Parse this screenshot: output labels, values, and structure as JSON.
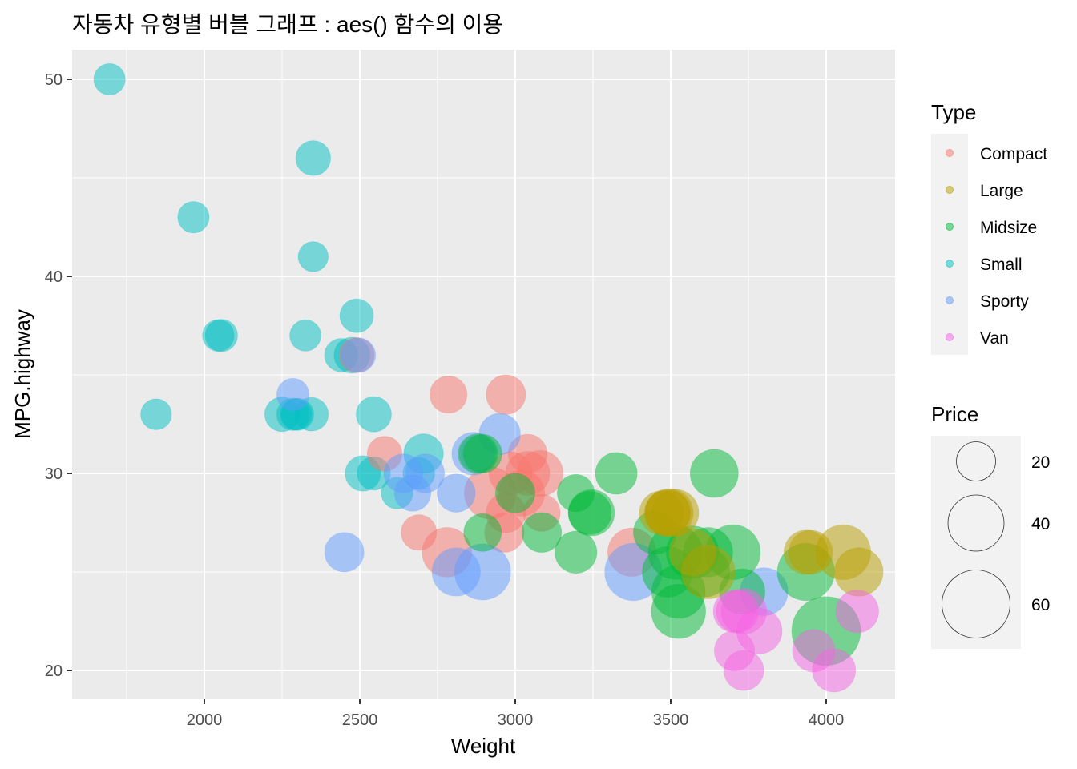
{
  "chart_data": {
    "type": "scatter",
    "subtype": "bubble",
    "title": "자동차 유형별 버블 그래프 : aes() 함수의 이용",
    "xlabel": "Weight",
    "ylabel": "MPG.highway",
    "xlim": [
      1600,
      4250
    ],
    "ylim": [
      18.5,
      51.5
    ],
    "x_ticks": [
      2000,
      2500,
      3000,
      3500,
      4000
    ],
    "y_ticks": [
      20,
      30,
      40,
      50
    ],
    "x_tick_labels": [
      "2000",
      "2500",
      "3000",
      "3500",
      "4000"
    ],
    "y_tick_labels": [
      "20",
      "30",
      "40",
      "50"
    ],
    "grid": true,
    "point_alpha": 0.5,
    "color_legend": {
      "title": "Type",
      "placement": "right",
      "entries": [
        {
          "label": "Compact",
          "color": "#F8766D"
        },
        {
          "label": "Large",
          "color": "#B79F00"
        },
        {
          "label": "Midsize",
          "color": "#00BA38"
        },
        {
          "label": "Small",
          "color": "#00BFC4"
        },
        {
          "label": "Sporty",
          "color": "#619CFF"
        },
        {
          "label": "Van",
          "color": "#F564E3"
        }
      ]
    },
    "size_legend": {
      "title": "Price",
      "placement": "right",
      "breaks": [
        20,
        40,
        60
      ],
      "labels": [
        "20",
        "40",
        "60"
      ]
    },
    "series": [
      {
        "name": "Small",
        "points": [
          {
            "x": 2705,
            "y": 31,
            "size": 15.9
          },
          {
            "x": 2295,
            "y": 33,
            "size": 8.4
          },
          {
            "x": 2350,
            "y": 41,
            "size": 7.4
          },
          {
            "x": 2345,
            "y": 33,
            "size": 10.1
          },
          {
            "x": 2325,
            "y": 37,
            "size": 8.3
          },
          {
            "x": 2055,
            "y": 37,
            "size": 9.1
          },
          {
            "x": 1845,
            "y": 33,
            "size": 8.0
          },
          {
            "x": 2440,
            "y": 36,
            "size": 10.0
          },
          {
            "x": 2285,
            "y": 33,
            "size": 9.2
          },
          {
            "x": 2045,
            "y": 37,
            "size": 8.6
          },
          {
            "x": 2490,
            "y": 38,
            "size": 10.3
          },
          {
            "x": 2545,
            "y": 33,
            "size": 11.6
          },
          {
            "x": 2350,
            "y": 46,
            "size": 11.3
          },
          {
            "x": 1695,
            "y": 50,
            "size": 8.4
          },
          {
            "x": 1965,
            "y": 43,
            "size": 8.4
          },
          {
            "x": 2250,
            "y": 33,
            "size": 11.1
          },
          {
            "x": 2475,
            "y": 36,
            "size": 12.2
          },
          {
            "x": 2690,
            "y": 30,
            "size": 8.7
          },
          {
            "x": 2510,
            "y": 30,
            "size": 11.8
          },
          {
            "x": 2620,
            "y": 29,
            "size": 8.6
          },
          {
            "x": 2545,
            "y": 30,
            "size": 9.9
          },
          {
            "x": 2300,
            "y": 33,
            "size": 9.0
          }
        ]
      },
      {
        "name": "Compact",
        "points": [
          {
            "x": 2490,
            "y": 36,
            "size": 11.4
          },
          {
            "x": 2785,
            "y": 34,
            "size": 13.4
          },
          {
            "x": 2970,
            "y": 34,
            "size": 15.7
          },
          {
            "x": 3040,
            "y": 31,
            "size": 15.1
          },
          {
            "x": 2580,
            "y": 31,
            "size": 11.3
          },
          {
            "x": 3085,
            "y": 28,
            "size": 13.3
          },
          {
            "x": 2970,
            "y": 28,
            "size": 15.9
          },
          {
            "x": 2985,
            "y": 30,
            "size": 19.8
          },
          {
            "x": 3080,
            "y": 30,
            "size": 23.3
          },
          {
            "x": 2690,
            "y": 27,
            "size": 11.8
          },
          {
            "x": 2965,
            "y": 27,
            "size": 15.8
          },
          {
            "x": 2920,
            "y": 29,
            "size": 31.9
          },
          {
            "x": 3040,
            "y": 30,
            "size": 20.9
          },
          {
            "x": 2780,
            "y": 26,
            "size": 28.0
          },
          {
            "x": 3375,
            "y": 26,
            "size": 26.3
          },
          {
            "x": 3020,
            "y": 29,
            "size": 23.7
          }
        ]
      },
      {
        "name": "Sporty",
        "points": [
          {
            "x": 2285,
            "y": 34,
            "size": 9.1
          },
          {
            "x": 2495,
            "y": 36,
            "size": 11.1
          },
          {
            "x": 2710,
            "y": 30,
            "size": 14.9
          },
          {
            "x": 2865,
            "y": 31,
            "size": 19.5
          },
          {
            "x": 2950,
            "y": 32,
            "size": 17.7
          },
          {
            "x": 2895,
            "y": 25,
            "size": 38.0
          },
          {
            "x": 3380,
            "y": 25,
            "size": 40.1
          },
          {
            "x": 2810,
            "y": 25,
            "size": 26.3
          },
          {
            "x": 2450,
            "y": 26,
            "size": 15.6
          },
          {
            "x": 2810,
            "y": 29,
            "size": 14.4
          },
          {
            "x": 2640,
            "y": 30,
            "size": 15.1
          },
          {
            "x": 3800,
            "y": 24,
            "size": 25.8
          },
          {
            "x": 2670,
            "y": 29,
            "size": 12.5
          },
          {
            "x": 2880,
            "y": 31,
            "size": 13.0
          }
        ]
      },
      {
        "name": "Midsize",
        "points": [
          {
            "x": 2880,
            "y": 31,
            "size": 15.9
          },
          {
            "x": 3195,
            "y": 29,
            "size": 13.4
          },
          {
            "x": 3325,
            "y": 30,
            "size": 18.2
          },
          {
            "x": 3640,
            "y": 30,
            "size": 26.1
          },
          {
            "x": 3450,
            "y": 27,
            "size": 20.2
          },
          {
            "x": 3245,
            "y": 28,
            "size": 23.7
          },
          {
            "x": 3515,
            "y": 26,
            "size": 34.7
          },
          {
            "x": 3490,
            "y": 25,
            "size": 29.5
          },
          {
            "x": 3570,
            "y": 26,
            "size": 32.5
          },
          {
            "x": 3620,
            "y": 26,
            "size": 27.9
          },
          {
            "x": 3700,
            "y": 26,
            "size": 36.1
          },
          {
            "x": 3525,
            "y": 24,
            "size": 33.9
          },
          {
            "x": 3610,
            "y": 25,
            "size": 28.7
          },
          {
            "x": 3730,
            "y": 24,
            "size": 22.7
          },
          {
            "x": 3525,
            "y": 23,
            "size": 35.2
          },
          {
            "x": 3935,
            "y": 25,
            "size": 40.0
          },
          {
            "x": 3000,
            "y": 29,
            "size": 15.7
          },
          {
            "x": 3085,
            "y": 27,
            "size": 15.9
          },
          {
            "x": 3195,
            "y": 26,
            "size": 18.5
          },
          {
            "x": 3240,
            "y": 28,
            "size": 19.7
          },
          {
            "x": 2895,
            "y": 31,
            "size": 14.9
          },
          {
            "x": 2895,
            "y": 27,
            "size": 13.9
          },
          {
            "x": 4000,
            "y": 22,
            "size": 61.9
          }
        ]
      },
      {
        "name": "Large",
        "points": [
          {
            "x": 3470,
            "y": 28,
            "size": 20.8
          },
          {
            "x": 3490,
            "y": 28,
            "size": 23.7
          },
          {
            "x": 3495,
            "y": 28,
            "size": 26.3
          },
          {
            "x": 3620,
            "y": 25,
            "size": 34.3
          },
          {
            "x": 3935,
            "y": 26,
            "size": 20.9
          },
          {
            "x": 3950,
            "y": 26,
            "size": 20.7
          },
          {
            "x": 4055,
            "y": 26,
            "size": 36.1
          },
          {
            "x": 4105,
            "y": 25,
            "size": 26.7
          },
          {
            "x": 3515,
            "y": 28,
            "size": 24.4
          },
          {
            "x": 3490,
            "y": 28,
            "size": 21.5
          },
          {
            "x": 3570,
            "y": 26,
            "size": 24.4
          }
        ]
      },
      {
        "name": "Van",
        "points": [
          {
            "x": 3735,
            "y": 20,
            "size": 16.3
          },
          {
            "x": 3705,
            "y": 21,
            "size": 16.6
          },
          {
            "x": 3705,
            "y": 23,
            "size": 19.0
          },
          {
            "x": 3715,
            "y": 23,
            "size": 19.1
          },
          {
            "x": 4100,
            "y": 23,
            "size": 19.5
          },
          {
            "x": 3960,
            "y": 21,
            "size": 19.1
          },
          {
            "x": 4025,
            "y": 20,
            "size": 19.9
          },
          {
            "x": 3735,
            "y": 23,
            "size": 22.7
          },
          {
            "x": 3785,
            "y": 22,
            "size": 22.7
          }
        ]
      }
    ]
  }
}
